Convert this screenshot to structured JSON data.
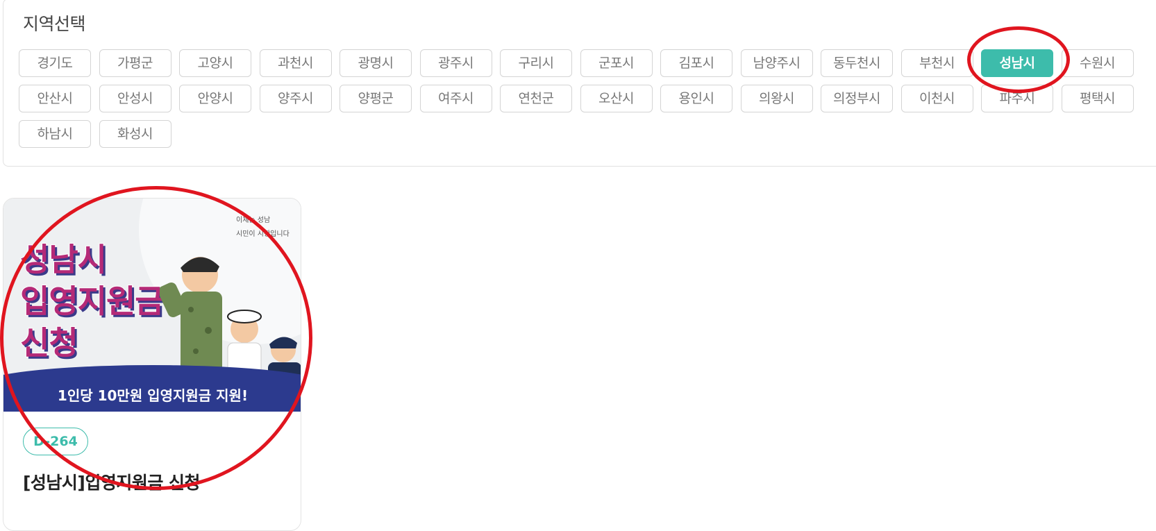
{
  "region": {
    "title": "지역선택",
    "selected": "성남시",
    "chips": [
      "경기도",
      "가평군",
      "고양시",
      "과천시",
      "광명시",
      "광주시",
      "구리시",
      "군포시",
      "김포시",
      "남양주시",
      "동두천시",
      "부천시",
      "성남시",
      "수원시",
      "안산시",
      "안성시",
      "안양시",
      "양주시",
      "양평군",
      "여주시",
      "연천군",
      "오산시",
      "용인시",
      "의왕시",
      "의정부시",
      "이천시",
      "파주시",
      "평택시",
      "하남시",
      "화성시"
    ]
  },
  "card": {
    "banner_lines": [
      "성남시",
      "입영지원금",
      "신청"
    ],
    "banner_sub": "1인당 10만원 입영지원금 지원!",
    "logo_line1": "이제는 성남",
    "logo_line2": "시민이 시장입니다",
    "dday": "D-264",
    "title": "[성남시]입영지원금 신청"
  },
  "colors": {
    "accent": "#3dbcab",
    "annotation": "#e0151f",
    "banner_band": "#2c3a8e",
    "banner_title": "#b52a77"
  }
}
